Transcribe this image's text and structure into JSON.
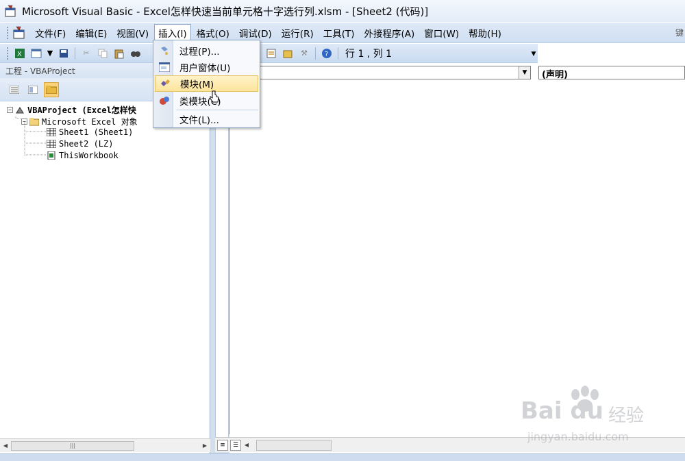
{
  "window": {
    "title": "Microsoft Visual Basic - Excel怎样快速当前单元格十字选行列.xlsm - [Sheet2 (代码)]"
  },
  "menubar": {
    "items": [
      "文件(F)",
      "编辑(E)",
      "视图(V)",
      "插入(I)",
      "格式(O)",
      "调试(D)",
      "运行(R)",
      "工具(T)",
      "外接程序(A)",
      "窗口(W)",
      "帮助(H)"
    ],
    "active_index": 3,
    "corner_text": "键"
  },
  "toolbar": {
    "position_text": "行 1 , 列 1"
  },
  "insert_menu": {
    "items": [
      {
        "label": "过程(P)...",
        "icon": "procedure-icon"
      },
      {
        "label": "用户窗体(U)",
        "icon": "userform-icon"
      },
      {
        "label": "模块(M)",
        "icon": "module-icon",
        "highlighted": true
      },
      {
        "label": "类模块(C)",
        "icon": "class-module-icon"
      },
      {
        "label": "文件(L)...",
        "icon": ""
      }
    ]
  },
  "project_pane": {
    "title": "工程 - VBAProject",
    "tree": {
      "root": "VBAProject (Excel怎样快",
      "folder": "Microsoft Excel 对象",
      "items": [
        "Sheet1 (Sheet1)",
        "Sheet2 (LZ)",
        "ThisWorkbook"
      ]
    }
  },
  "code_window": {
    "object_value": "",
    "procedure_value": "(声明)"
  },
  "watermark": {
    "brand": "Bai du",
    "brand_cn": "经验",
    "url": "jingyan.baidu.com"
  },
  "colors": {
    "menubar_bg": "#cfdff2",
    "highlight": "#fde49c",
    "selected_button": "#fbd27a"
  }
}
